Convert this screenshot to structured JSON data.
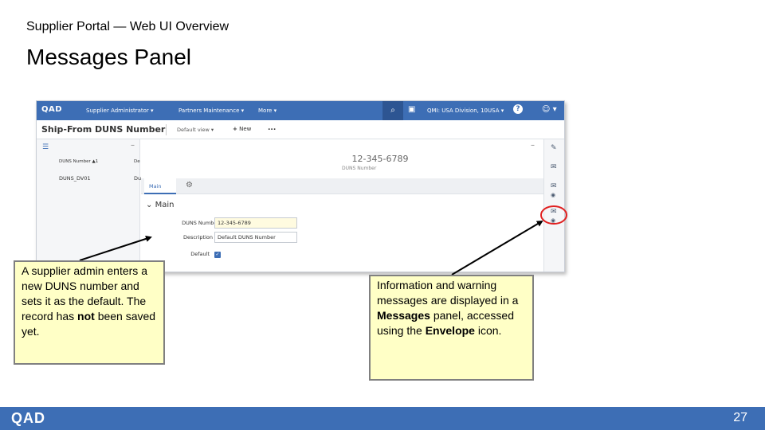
{
  "slide": {
    "subtitle": "Supplier Portal — Web UI Overview",
    "title": "Messages Panel",
    "page_number": "27",
    "footer_logo": "QAD"
  },
  "app": {
    "logo": "QAD",
    "menus": [
      "Supplier Administrator",
      "Partners Maintenance",
      "More"
    ],
    "entity": "QMI: USA Division, 10USA",
    "page_name": "Ship-From DUNS Number",
    "view_label": "Default view",
    "new_label": "New",
    "more_label": "...",
    "list": {
      "columns": [
        "DUNS Number",
        "De"
      ],
      "rows": [
        [
          "DUNS_DV01",
          "Du"
        ]
      ]
    },
    "detail": {
      "record_id": "12-345-6789",
      "record_label": "DUNS Number",
      "tabs": [
        "Main"
      ],
      "section": "Main",
      "fields": {
        "duns_label": "DUNS Number",
        "duns_value": "12-345-6789",
        "desc_label": "Description",
        "desc_value": "Default DUNS Number",
        "default_label": "Default"
      }
    }
  },
  "callouts": {
    "left": {
      "part1": "A supplier admin enters a new DUNS number and sets it as the default. The record has ",
      "bold": "not",
      "part2": " been saved yet."
    },
    "right": {
      "part1": "Information and warning messages are displayed in a ",
      "bold1": "Messages",
      "part2": " panel, accessed using the ",
      "bold2": "Envelope",
      "part3": " icon."
    }
  },
  "colors": {
    "brand_blue": "#3d6eb5",
    "callout_bg": "#ffffc6",
    "highlight_circle": "#e02020"
  }
}
